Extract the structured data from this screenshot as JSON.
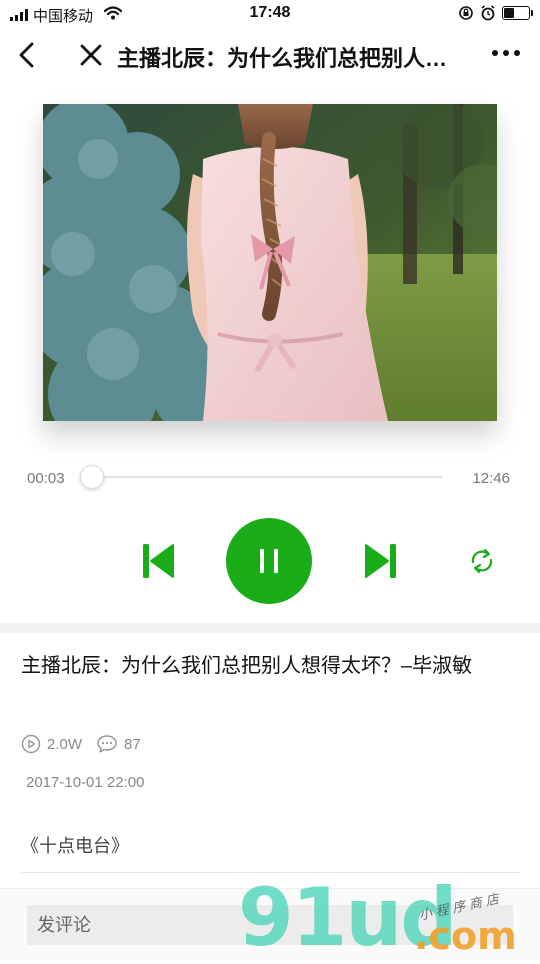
{
  "status_bar": {
    "carrier": "中国移动",
    "time": "17:48",
    "battery_level": 0.45
  },
  "nav": {
    "title": "主播北辰：为什么我们总把别人想得太坏？-毕淑敏",
    "back_icon": "chevron-left-icon",
    "close_icon": "close-icon",
    "more_icon": "more-dots-icon"
  },
  "player": {
    "current_time": "00:03",
    "total_time": "12:46",
    "progress": 0.004,
    "state": "playing",
    "accent_color": "#1aad19"
  },
  "episode": {
    "title": "主播北辰：为什么我们总把别人想得太坏？–毕淑敏",
    "plays": "2.0W",
    "comments": "87",
    "date": "2017-10-01 22:00",
    "album": "《十点电台》"
  },
  "comment": {
    "placeholder": "发评论"
  },
  "watermark": {
    "logo": "91ud",
    "domain": ".com",
    "tagline": "小程序商店"
  }
}
